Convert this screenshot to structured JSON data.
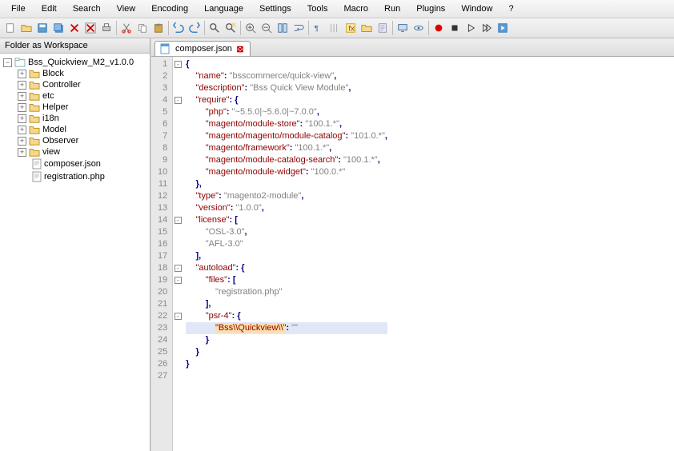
{
  "menu": [
    "File",
    "Edit",
    "Search",
    "View",
    "Encoding",
    "Language",
    "Settings",
    "Tools",
    "Macro",
    "Run",
    "Plugins",
    "Window",
    "?"
  ],
  "sidebar": {
    "title": "Folder as Workspace",
    "root": "Bss_Quickview_M2_v1.0.0",
    "folders": [
      "Block",
      "Controller",
      "etc",
      "Helper",
      "i18n",
      "Model",
      "Observer",
      "view"
    ],
    "files": [
      "composer.json",
      "registration.php"
    ]
  },
  "tab": {
    "name": "composer.json"
  },
  "lines": [
    "1",
    "2",
    "3",
    "4",
    "5",
    "6",
    "7",
    "8",
    "9",
    "10",
    "11",
    "12",
    "13",
    "14",
    "15",
    "16",
    "17",
    "18",
    "19",
    "20",
    "21",
    "22",
    "23",
    "24",
    "25",
    "26",
    "27"
  ],
  "code": {
    "l1": "{",
    "l2a": "\"name\"",
    "l2b": "\"bsscommerce/quick-view\"",
    "l3a": "\"description\"",
    "l3b": "\"Bss Quick View Module\"",
    "l4a": "\"require\"",
    "l5a": "\"php\"",
    "l5b": "\"~5.5.0|~5.6.0|~7.0.0\"",
    "l6a": "\"magento/module-store\"",
    "l6b": "\"100.1.*\"",
    "l7a": "\"magento/magento/module-catalog\"",
    "l7b": "\"101.0.*\"",
    "l8a": "\"magento/framework\"",
    "l8b": "\"100.1.*\"",
    "l9a": "\"magento/module-catalog-search\"",
    "l9b": "\"100.1.*\"",
    "l10a": "\"magento/module-widget\"",
    "l10b": "\"100.0.*\"",
    "l12a": "\"type\"",
    "l12b": "\"magento2-module\"",
    "l13a": "\"version\"",
    "l13b": "\"1.0.0\"",
    "l14a": "\"license\"",
    "l15": "\"OSL-3.0\"",
    "l16": "\"AFL-3.0\"",
    "l18a": "\"autoload\"",
    "l19a": "\"files\"",
    "l20": "\"registration.php\"",
    "l22a": "\"psr-4\"",
    "l23a": "\"Bss\\\\Quickview\\\\\"",
    "l23b": "\"\"",
    "p_colon": ": ",
    "p_comma": ",",
    "p_obr": "{",
    "p_cbr": "}",
    "p_osb": "[",
    "p_csb": "]",
    "ind1": "    ",
    "ind2": "        ",
    "ind3": "            "
  }
}
